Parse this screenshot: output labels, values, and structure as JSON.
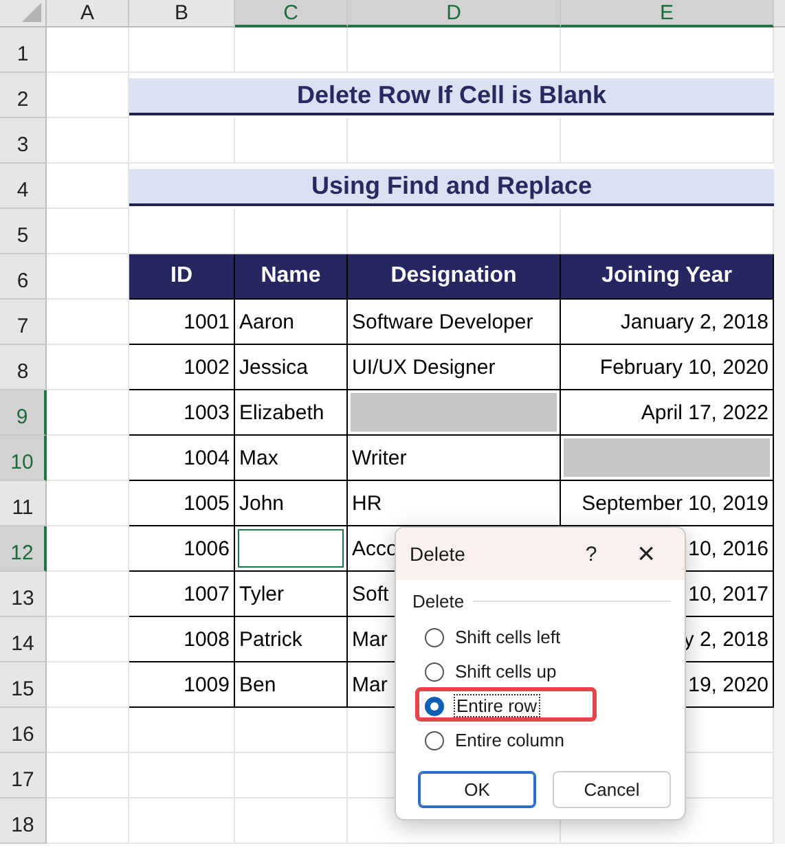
{
  "sheet": {
    "column_headers": [
      {
        "label": "A",
        "selected": false
      },
      {
        "label": "B",
        "selected": false
      },
      {
        "label": "C",
        "selected": true
      },
      {
        "label": "D",
        "selected": true
      },
      {
        "label": "E",
        "selected": true
      }
    ],
    "row_headers": [
      {
        "label": "1",
        "selected": false
      },
      {
        "label": "2",
        "selected": false
      },
      {
        "label": "3",
        "selected": false
      },
      {
        "label": "4",
        "selected": false
      },
      {
        "label": "5",
        "selected": false
      },
      {
        "label": "6",
        "selected": false
      },
      {
        "label": "7",
        "selected": false
      },
      {
        "label": "8",
        "selected": false
      },
      {
        "label": "9",
        "selected": true
      },
      {
        "label": "10",
        "selected": true
      },
      {
        "label": "11",
        "selected": false
      },
      {
        "label": "12",
        "selected": true
      },
      {
        "label": "13",
        "selected": false
      },
      {
        "label": "14",
        "selected": false
      },
      {
        "label": "15",
        "selected": false
      },
      {
        "label": "16",
        "selected": false
      },
      {
        "label": "17",
        "selected": false
      },
      {
        "label": "18",
        "selected": false
      }
    ],
    "titles": [
      "Delete Row If Cell is Blank",
      "Using Find and Replace"
    ],
    "table": {
      "columns": [
        "ID",
        "Name",
        "Designation",
        "Joining Year"
      ],
      "rows": [
        [
          {
            "kind": "number",
            "text": "1001"
          },
          {
            "kind": "text",
            "text": "Aaron"
          },
          {
            "kind": "text",
            "text": "Software Developer"
          },
          {
            "kind": "number",
            "text": "January 2, 2018"
          }
        ],
        [
          {
            "kind": "number",
            "text": "1002"
          },
          {
            "kind": "text",
            "text": "Jessica"
          },
          {
            "kind": "text",
            "text": "UI/UX Designer"
          },
          {
            "kind": "number",
            "text": "February 10, 2020"
          }
        ],
        [
          {
            "kind": "number",
            "text": "1003"
          },
          {
            "kind": "text",
            "text": "Elizabeth"
          },
          {
            "kind": "blank",
            "active": false
          },
          {
            "kind": "number",
            "text": "April 17, 2022"
          }
        ],
        [
          {
            "kind": "number",
            "text": "1004"
          },
          {
            "kind": "text",
            "text": "Max"
          },
          {
            "kind": "text",
            "text": "Writer"
          },
          {
            "kind": "blank",
            "active": false
          }
        ],
        [
          {
            "kind": "number",
            "text": "1005"
          },
          {
            "kind": "text",
            "text": "John"
          },
          {
            "kind": "text",
            "text": "HR"
          },
          {
            "kind": "number",
            "text": "September 10, 2019"
          }
        ],
        [
          {
            "kind": "number",
            "text": "1006"
          },
          {
            "kind": "blank",
            "active": true
          },
          {
            "kind": "text",
            "text": "Acco"
          },
          {
            "kind": "number",
            "text": "10, 2016"
          }
        ],
        [
          {
            "kind": "number",
            "text": "1007"
          },
          {
            "kind": "text",
            "text": "Tyler"
          },
          {
            "kind": "text",
            "text": "Soft"
          },
          {
            "kind": "number",
            "text": "10, 2017"
          }
        ],
        [
          {
            "kind": "number",
            "text": "1008"
          },
          {
            "kind": "text",
            "text": "Patrick"
          },
          {
            "kind": "text",
            "text": "Mar"
          },
          {
            "kind": "number",
            "text": "y 2, 2018"
          }
        ],
        [
          {
            "kind": "number",
            "text": "1009"
          },
          {
            "kind": "text",
            "text": "Ben"
          },
          {
            "kind": "text",
            "text": "Mar"
          },
          {
            "kind": "number",
            "text": "19, 2020"
          }
        ]
      ]
    }
  },
  "dialog": {
    "title": "Delete",
    "help": "?",
    "close": "×",
    "group": "Delete",
    "options": [
      {
        "label": "Shift cells left",
        "selected": false,
        "highlighted": false
      },
      {
        "label": "Shift cells up",
        "selected": false,
        "highlighted": false
      },
      {
        "label": "Entire row",
        "selected": true,
        "highlighted": true
      },
      {
        "label": "Entire column",
        "selected": false,
        "highlighted": false
      }
    ],
    "buttons": [
      {
        "label": "OK",
        "default": true
      },
      {
        "label": "Cancel",
        "default": false
      }
    ]
  }
}
